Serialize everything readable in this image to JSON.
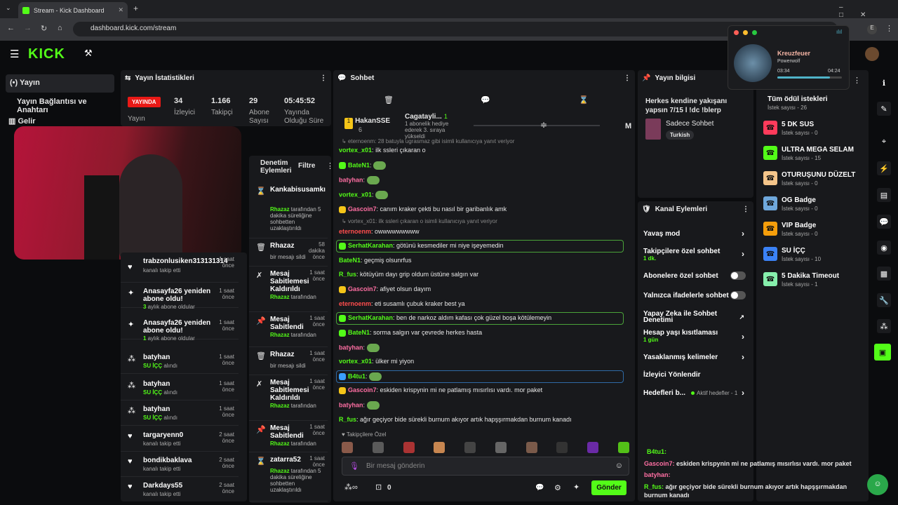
{
  "browser": {
    "tab_title": "Stream - Kick Dashboard",
    "url": "dashboard.kick.com/stream"
  },
  "sidebar": {
    "items": [
      {
        "label": "Yayın"
      },
      {
        "label": "Yayın Bağlantısı ve Anahtarı"
      },
      {
        "label": "Gelir"
      }
    ]
  },
  "stats": {
    "title": "Yayın İstatistikleri",
    "live_badge": "YAYINDA",
    "live_label": "Yayın",
    "items": [
      {
        "value": "34",
        "label": "İzleyici"
      },
      {
        "value": "1.166",
        "label": "Takipçi"
      },
      {
        "value": "29",
        "label": "Abone Sayısı"
      },
      {
        "value": "05:45:52",
        "label": "Yayında Olduğu Süre"
      }
    ]
  },
  "activity": [
    {
      "name": "trabzonlusiken313131314",
      "sub": "kanalı takip etti",
      "time": "1 saat önce",
      "icon": "heart-icon"
    },
    {
      "name": "Anasayfa26 yeniden abone oldu!",
      "sub_a": "3",
      "sub_b": " aylık abone oldular",
      "time": "1 saat önce",
      "icon": "sparkle-icon"
    },
    {
      "name": "Anasayfa26 yeniden abone oldu!",
      "sub_a": "1",
      "sub_b": " aylık abone oldular",
      "time": "1 saat önce",
      "icon": "sparkle-icon"
    },
    {
      "name": "batyhan",
      "sub_a": "SU İÇÇ",
      "sub_b": " alındı",
      "time": "1 saat önce",
      "icon": "reward-icon"
    },
    {
      "name": "batyhan",
      "sub_a": "SU İÇÇ",
      "sub_b": " alındı",
      "time": "1 saat önce",
      "icon": "reward-icon"
    },
    {
      "name": "batyhan",
      "sub_a": "SU İÇÇ",
      "sub_b": " alındı",
      "time": "1 saat önce",
      "icon": "reward-icon"
    },
    {
      "name": "targaryenn0",
      "sub": "kanalı takip etti",
      "time": "2 saat önce",
      "icon": "heart-icon"
    },
    {
      "name": "bondikbaklava",
      "sub": "kanalı takip etti",
      "time": "2 saat önce",
      "icon": "heart-icon"
    },
    {
      "name": "Darkdays55",
      "sub": "kanalı takip etti",
      "time": "2 saat önce",
      "icon": "heart-icon"
    }
  ],
  "modlog": {
    "title": "Denetim Eylemleri",
    "filter": "Filtre",
    "items": [
      {
        "title": "Kankabisusamkı",
        "time": "",
        "by": "Rhazaz",
        "desc": "tarafından 5 dakika süreliğine sohbetten uzaklaştırıldı"
      },
      {
        "title": "Rhazaz",
        "time": "58 dakika önce",
        "desc": "bir mesajı sildi"
      },
      {
        "title": "Mesaj Sabitlemesi Kaldırıldı",
        "time": "1 saat önce",
        "by": "Rhazaz",
        "desc": "tarafından"
      },
      {
        "title": "Mesaj Sabitlendi",
        "time": "1 saat önce",
        "by": "Rhazaz",
        "desc": "tarafından"
      },
      {
        "title": "Rhazaz",
        "time": "1 saat önce",
        "desc": "bir mesajı sildi"
      },
      {
        "title": "Mesaj Sabitlemesi Kaldırıldı",
        "time": "1 saat önce",
        "by": "Rhazaz",
        "desc": "tarafından"
      },
      {
        "title": "Mesaj Sabitlendi",
        "time": "1 saat önce",
        "by": "Rhazaz",
        "desc": "tarafından"
      },
      {
        "title": "zatarra52",
        "time": "1 saat önce",
        "by": "Rhazaz",
        "desc": "tarafından 5 dakika süreliğine sohbetten uzaklaştırıldı"
      }
    ]
  },
  "chat": {
    "title": "Sohbet",
    "top1_name": "HakanSSE",
    "top1_count": "6",
    "top2_name": "Cagatayli...",
    "top2_count": "1",
    "top2_desc": "1 abonelik hediye ederek 3. sıraya yükseldi",
    "top_m": "M",
    "reply1": "eternoenm: 28 batuyla ugrasmaz gibi isimli kullanıcıya yanıt veriyor",
    "messages": [
      {
        "u": "vortex_x01",
        "c": "#53fc18",
        "t": "ilk ssleri çıkaran o"
      },
      {
        "u": "BateN1",
        "c": "#53fc18",
        "t": ""
      },
      {
        "u": "batyhan",
        "c": "#ff6fa3",
        "t": ""
      },
      {
        "u": "vortex_x01",
        "c": "#53fc18",
        "t": ""
      },
      {
        "u": "Gascoin7",
        "c": "#ff6fa3",
        "t": "canım kraker çekti bu nasıl bir garibanlık amk"
      },
      {
        "u": "eternoenm",
        "c": "#ff4d4d",
        "t": "owwwwwwwww"
      },
      {
        "u": "SerhatKarahan",
        "c": "#53fc18",
        "t": "götünü kesmediler mi niye işeyemedin"
      },
      {
        "u": "BateN1",
        "c": "#53fc18",
        "t": "geçmiş olsunrfus"
      },
      {
        "u": "R_fus",
        "c": "#53fc18",
        "t": "kötüyüm dayı grip oldum üstüne salgın var"
      },
      {
        "u": "Gascoin7",
        "c": "#ff6fa3",
        "t": "afiyet olsun dayım"
      },
      {
        "u": "eternoenm",
        "c": "#ff4d4d",
        "t": "eti susamlı çubuk kraker best ya"
      },
      {
        "u": "SerhatKarahan",
        "c": "#53fc18",
        "t": "ben de narkoz aldım kafası çok güzel boşa kötülemeyin"
      },
      {
        "u": "BateN1",
        "c": "#53fc18",
        "t": "sorma salgın var çevrede herkes hasta"
      },
      {
        "u": "batyhan",
        "c": "#ff6fa3",
        "t": ""
      },
      {
        "u": "vortex_x01",
        "c": "#53fc18",
        "t": "ülker mi yiyon"
      },
      {
        "u": "B4tu1",
        "c": "#53fc18",
        "t": ""
      },
      {
        "u": "Gascoin7",
        "c": "#ff6fa3",
        "t": "eskiden krispynin mi ne patlamış mısırlısı vardı. mor paket"
      },
      {
        "u": "batyhan",
        "c": "#ff6fa3",
        "t": ""
      },
      {
        "u": "R_fus",
        "c": "#53fc18",
        "t": "ağır geçiyor bide sürekli burnum akıyor artık hapşşırmakdan burnum kanadı"
      }
    ],
    "reply2": "vortex_x01: ilk ssleri çıkaran o     isimli kullanıcıya yanıt veriyor",
    "follower_label": "Takipçilere Özel",
    "placeholder": "Bir mesaj gönderin",
    "count": "0",
    "send": "Gönder"
  },
  "stream_info": {
    "title": "Yayın bilgisi",
    "stream_title": "Herkes kendine yakışanı yapsın 7/15 l !dc !blerp",
    "category": "Sadece Sohbet",
    "tag": "Turkish"
  },
  "channel_actions": {
    "title": "Kanal Eylemleri",
    "slow": "Yavaş mod",
    "followers": "Takipçilere özel sohbet",
    "followers_sub": "1 dk.",
    "subs": "Abonelere özel sohbet",
    "emotes": "Yalnızca ifadelerle sohbet",
    "ai_mod": "Yapay Zeka ile Sohbet Denetimi",
    "age": "Hesap yaşı kısıtlaması",
    "age_sub": "1 gün",
    "banned": "Yasaklanmış kelimeler",
    "redirect": "İzleyici Yönlendir",
    "goals": "Hedefleri b...",
    "goals_sub": "Aktif hedefler - 1"
  },
  "rewards": {
    "header": "Tüm ödül istekleri",
    "header_sub": "İstek sayısı - 26",
    "items": [
      {
        "name": "5 DK SUS",
        "sub": "İstek sayısı - 0",
        "color": "#ff3b5b"
      },
      {
        "name": "ULTRA MEGA SELAM",
        "sub": "İstek sayısı - 15",
        "color": "#53fc18"
      },
      {
        "name": "OTURUŞUNU DÜZELT",
        "sub": "İstek sayısı - 0",
        "color": "#f5c58a"
      },
      {
        "name": "OG Badge",
        "sub": "İstek sayısı - 0",
        "color": "#6fa8dc"
      },
      {
        "name": "VIP Badge",
        "sub": "İstek sayısı - 0",
        "color": "#f59e0b"
      },
      {
        "name": "SU İÇÇ",
        "sub": "İstek sayısı - 10",
        "color": "#3b82f6"
      },
      {
        "name": "5 Dakika Timeout",
        "sub": "İstek sayısı - 1",
        "color": "#86efac"
      }
    ]
  },
  "music": {
    "track": "Kreuzfeuer",
    "artist": "Powerwolf",
    "elapsed": "03:34",
    "total": "04:24",
    "progress": 0.81
  },
  "overlay": {
    "l1_user": "B4tu1:",
    "l2_user": "Gascoin7:",
    "l2_text": "eskiden krispynin mi ne patlamış mısırlısı vardı. mor paket",
    "l3_user": "batyhan:",
    "l4_user": "R_fus:",
    "l4_text": "ağır geçiyor bide sürekli burnum akıyor artık hapşşırmakdan burnum kanadı"
  }
}
